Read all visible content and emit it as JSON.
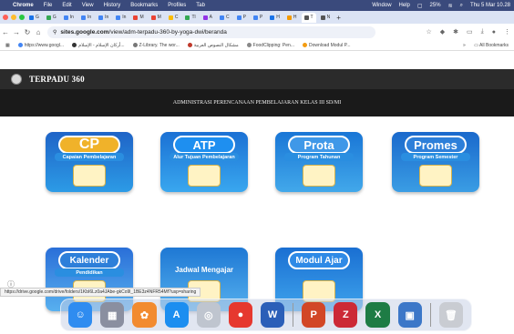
{
  "menubar": {
    "app_name": "Chrome",
    "items": [
      "File",
      "Edit",
      "View",
      "History",
      "Bookmarks",
      "Profiles",
      "Tab",
      "Window",
      "Help"
    ],
    "battery": "25%",
    "clock": "Thu 5 Mar 10.28"
  },
  "tabs": [
    {
      "label": "G",
      "color": "#1a73e8"
    },
    {
      "label": "G",
      "color": "#34a853"
    },
    {
      "label": "In",
      "color": "#4285f4"
    },
    {
      "label": "In",
      "color": "#4285f4"
    },
    {
      "label": "In",
      "color": "#4285f4"
    },
    {
      "label": "In",
      "color": "#4285f4"
    },
    {
      "label": "M",
      "color": "#ea4335"
    },
    {
      "label": "M",
      "color": "#ea4335"
    },
    {
      "label": "C",
      "color": "#fbbc04"
    },
    {
      "label": "Tl",
      "color": "#34a853"
    },
    {
      "label": "A",
      "color": "#9334e6"
    },
    {
      "label": "C",
      "color": "#4285f4"
    },
    {
      "label": "P",
      "color": "#4285f4"
    },
    {
      "label": "P",
      "color": "#4285f4"
    },
    {
      "label": "H",
      "color": "#1a73e8"
    },
    {
      "label": "H",
      "color": "#f29900"
    },
    {
      "label": "T",
      "color": "#555555",
      "active": true
    },
    {
      "label": "N",
      "color": "#555555"
    }
  ],
  "addressbar": {
    "host": "sites.google.com",
    "path": "/view/adm-terpadu-360-by-yoga-dwi/beranda"
  },
  "bookmarks": {
    "items": [
      "https://www.googl...",
      "أركان الإسلام - الإسلام...",
      "Z-Library. The wor...",
      "مشكال النصوص العربية",
      "FoodClipping: Pen...",
      "Download Modul P..."
    ],
    "overflow": "»",
    "all_label": "All Bookmarks"
  },
  "site": {
    "title": "TERPADU 360",
    "subtitle": "ADMINISTRASI PERENCANAAN PEMBELAJARAN KELAS III SD/MI"
  },
  "cards": {
    "cp": {
      "title": "CP",
      "subtitle": "Capaian Pembelajaran"
    },
    "atp": {
      "title": "ATP",
      "subtitle": "Alur Tujuan Pembelajaran"
    },
    "prota": {
      "title": "Prota",
      "subtitle": "Program Tahunan"
    },
    "promes": {
      "title": "Promes",
      "subtitle": "Program Semester"
    },
    "kalender": {
      "title": "Kalender",
      "subtitle": "Pendidikan"
    },
    "jadwal": {
      "title": "Jadwal Mengajar",
      "subtitle": ""
    },
    "modul": {
      "title": "Modul Ajar",
      "subtitle": ""
    }
  },
  "statusbar": {
    "url": "https://drive.google.com/drive/folders/1KbI6Lz0a4JAbe-gkCo9l_1BE3z4NFR54Mf?usp=sharing"
  },
  "dock": {
    "apps": [
      {
        "name": "finder-icon",
        "color": "#2f8cf0",
        "glyph": "☺"
      },
      {
        "name": "launchpad-icon",
        "color": "#8a8fa0",
        "glyph": "▦"
      },
      {
        "name": "photos-icon",
        "color": "#f28b30",
        "glyph": "✿"
      },
      {
        "name": "appstore-icon",
        "color": "#1c8ef0",
        "glyph": "A"
      },
      {
        "name": "safari-icon",
        "color": "#bfc5cf",
        "glyph": "◎"
      },
      {
        "name": "chrome-icon",
        "color": "#e6382f",
        "glyph": "●"
      },
      {
        "name": "word-icon",
        "color": "#2b5fb8",
        "glyph": "W"
      },
      {
        "name": "powerpoint-icon",
        "color": "#d24726",
        "glyph": "P"
      },
      {
        "name": "zotero-icon",
        "color": "#cc2936",
        "glyph": "Z"
      },
      {
        "name": "excel-icon",
        "color": "#1e7c45",
        "glyph": "X"
      },
      {
        "name": "preview-icon",
        "color": "#3c77c8",
        "glyph": "▣"
      },
      {
        "name": "trash-icon",
        "color": "#c9ccd2",
        "glyph": "🗑"
      }
    ]
  }
}
